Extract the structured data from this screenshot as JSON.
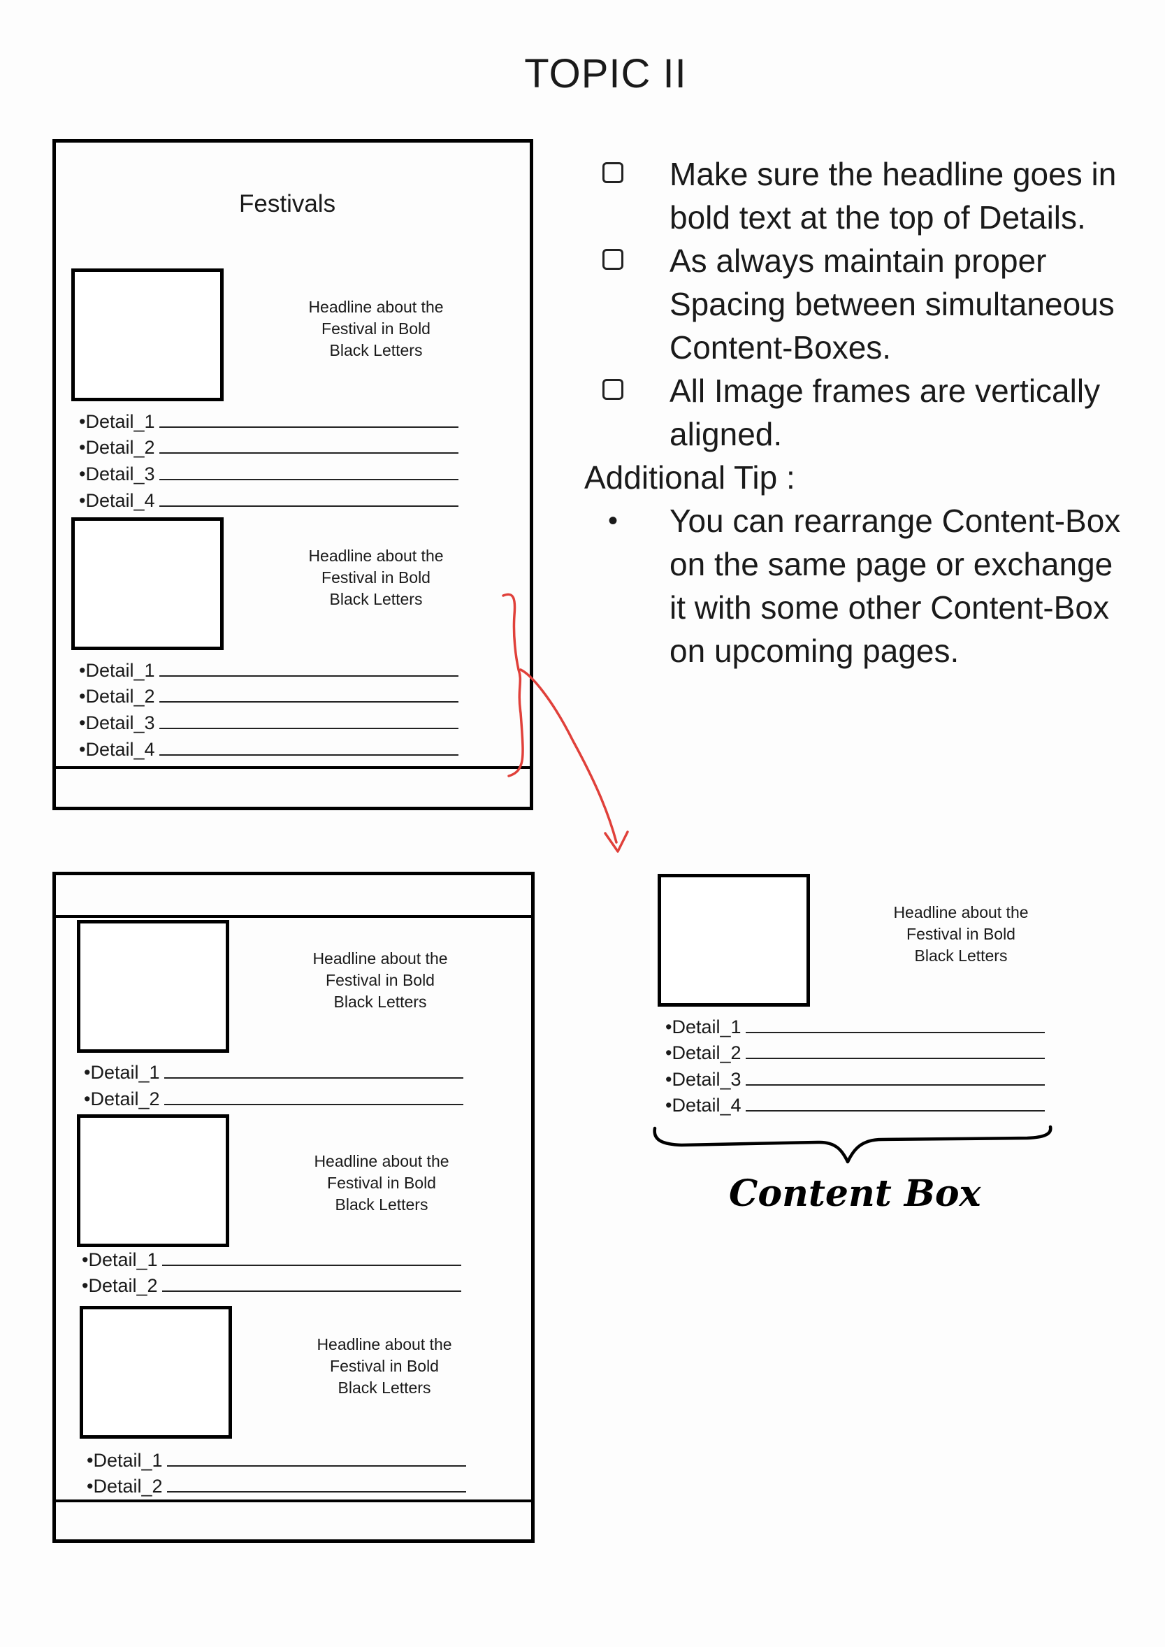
{
  "title": "TOPIC II",
  "mock_page_1": {
    "heading": "Festivals",
    "boxes": [
      {
        "headline_lines": [
          "Headline about the",
          "Festival in Bold",
          "Black Letters"
        ],
        "details": [
          "•Detail_1",
          "•Detail_2",
          "•Detail_3",
          "•Detail_4"
        ]
      },
      {
        "headline_lines": [
          "Headline about the",
          "Festival in Bold",
          "Black Letters"
        ],
        "details": [
          "•Detail_1",
          "•Detail_2",
          "•Detail_3",
          "•Detail_4"
        ]
      }
    ]
  },
  "mock_page_2": {
    "boxes": [
      {
        "headline_lines": [
          "Headline about the",
          "Festival in Bold",
          "Black Letters"
        ],
        "details": [
          "•Detail_1",
          "•Detail_2"
        ]
      },
      {
        "headline_lines": [
          "Headline about the",
          "Festival in Bold",
          "Black Letters"
        ],
        "details": [
          "•Detail_1",
          "•Detail_2"
        ]
      },
      {
        "headline_lines": [
          "Headline about the",
          "Festival in Bold",
          "Black Letters"
        ],
        "details": [
          "•Detail_1",
          "•Detail_2"
        ]
      }
    ]
  },
  "content_box": {
    "headline_lines": [
      "Headline about the",
      "Festival in Bold",
      "Black Letters"
    ],
    "details": [
      "•Detail_1",
      "•Detail_2",
      "•Detail_3",
      "•Detail_4"
    ],
    "label": "Content Box"
  },
  "checklist": {
    "items": [
      {
        "lines": [
          "Make sure the headline goes in",
          "bold text at the top of Details."
        ]
      },
      {
        "lines": [
          "As always maintain proper",
          "Spacing between simultaneous",
          "Content-Boxes."
        ]
      },
      {
        "lines": [
          "All Image frames are vertically",
          "aligned."
        ]
      }
    ],
    "tip_title": "Additional Tip :",
    "tip_lines": [
      "You can rearrange Content-Box",
      "on the same page or exchange",
      "it with some other Content-Box",
      "on upcoming pages."
    ]
  },
  "colors": {
    "arrow": "#e0403a",
    "ink": "#000000"
  },
  "icons": {
    "checkbox": "checkbox-icon",
    "bullet": "bullet-icon",
    "arrow": "arrow-icon",
    "brace": "curly-brace-icon"
  }
}
